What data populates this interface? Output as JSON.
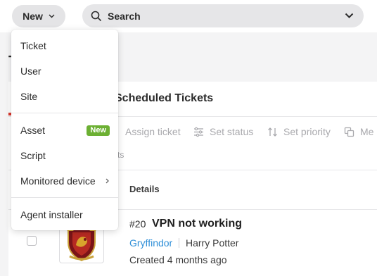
{
  "topbar": {
    "new_label": "New",
    "search_placeholder": "Search"
  },
  "page": {
    "heading_partial": "T",
    "card_title": "Scheduled Tickets",
    "toolbar": [
      {
        "label": "Assign ticket",
        "icon": "assign-icon"
      },
      {
        "label": "Set status",
        "icon": "sliders-icon"
      },
      {
        "label": "Set priority",
        "icon": "sort-icon"
      },
      {
        "label": "Me",
        "icon": "merge-icon"
      }
    ],
    "subtitle_partial": "ts",
    "column_header": "Details",
    "ticket": {
      "number": "#20",
      "title": "VPN not working",
      "organization": "Gryffindor",
      "contact": "Harry Potter",
      "created": "Created 4 months ago"
    }
  },
  "menu": {
    "items": [
      {
        "label": "Ticket"
      },
      {
        "label": "User"
      },
      {
        "label": "Site"
      },
      {
        "label": "Asset",
        "badge": "New"
      },
      {
        "label": "Script"
      },
      {
        "label": "Monitored device",
        "has_submenu": true
      },
      {
        "label": "Agent installer"
      }
    ]
  },
  "colors": {
    "badge": "#6cb033",
    "link": "#2f8fd8",
    "accent": "#d9382f"
  }
}
